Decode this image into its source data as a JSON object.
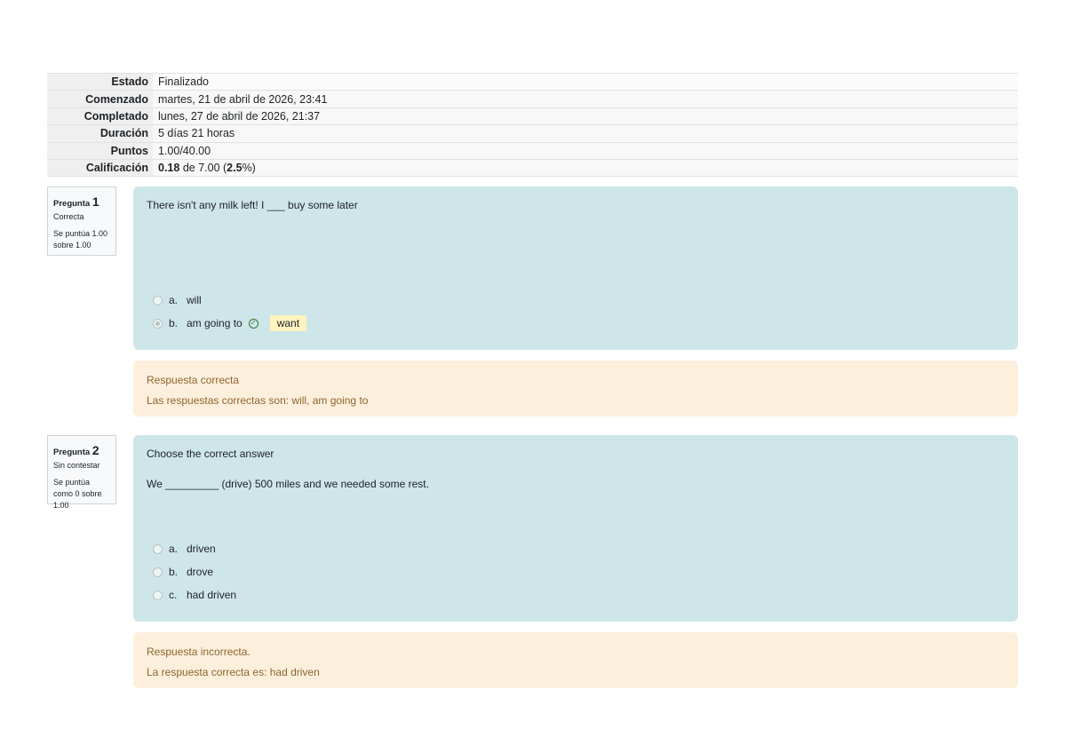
{
  "summary": [
    {
      "label": "Estado",
      "value": "Finalizado"
    },
    {
      "label": "Comenzado",
      "value": "martes, 21 de abril de 2026, 23:41"
    },
    {
      "label": "Completado",
      "value": "lunes, 27 de abril de 2026, 21:37"
    },
    {
      "label": "Duración",
      "value": "5 días 21 horas"
    },
    {
      "label": "Puntos",
      "value": "1.00/40.00"
    }
  ],
  "grade": {
    "label": "Calificación",
    "score": "0.18",
    "of": " de 7.00 (",
    "percent": "2.5",
    "tail": "%)"
  },
  "questions": [
    {
      "word": "Pregunta",
      "number": "1",
      "state": "Correcta",
      "grade": "Se puntúa 1.00 sobre 1.00",
      "text": "There isn't any milk left! I ___  buy some later",
      "options": [
        {
          "letter": "a.",
          "text": "will"
        },
        {
          "letter": "b.",
          "text": "am going to",
          "tag": "want"
        }
      ],
      "feedback": {
        "outcome": "Respuesta correcta",
        "right": "Las respuestas correctas son: will, am going to"
      }
    },
    {
      "word": "Pregunta",
      "number": "2",
      "state": "Sin contestar",
      "grade": "Se puntúa como 0 sobre 1.00",
      "intro": "Choose the correct answer",
      "text": "We _________ (drive) 500 miles and we needed some rest.",
      "options": [
        {
          "letter": "a.",
          "text": "driven"
        },
        {
          "letter": "b.",
          "text": "drove"
        },
        {
          "letter": "c.",
          "text": "had driven"
        }
      ],
      "feedback": {
        "outcome": "Respuesta incorrecta.",
        "right": "La respuesta correcta es: had driven"
      }
    }
  ],
  "colors": {
    "question_bg": "#cee6ea",
    "feedback_bg": "#fcefdc",
    "feedback_text": "#8e662e",
    "correct": "#357a32",
    "highlight": "#fff3bf"
  },
  "icons": {
    "correct": "check-circle-icon",
    "radio": "radio-button-icon"
  }
}
